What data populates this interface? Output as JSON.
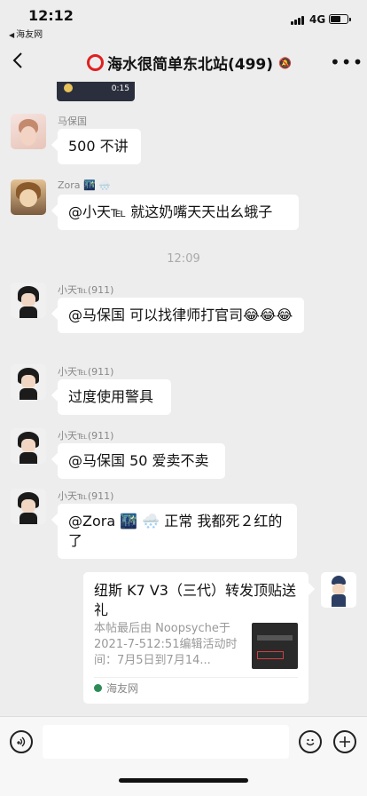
{
  "status_bar": {
    "time": "12:12",
    "back_app": "海友网",
    "network": "4G",
    "battery_level": 0.6
  },
  "header": {
    "title": "海水很简单东北站(499)"
  },
  "chat": {
    "video_duration": "0:15",
    "messages": [
      {
        "sender": "马保国",
        "text": "500 不讲"
      },
      {
        "sender": "Zora 🌃 🌨️",
        "text": "@小天℡ 就这奶嘴天天出幺蛾子"
      },
      {
        "sender": "小天℡(911)",
        "text": "@马保国 可以找律师打官司😂😂😂"
      },
      {
        "sender": "小天℡(911)",
        "text": "过度使用警具"
      },
      {
        "sender": "小天℡(911)",
        "text": "@马保国 50 爱卖不卖"
      },
      {
        "sender": "小天℡(911)",
        "text": "@Zora 🌃 🌨️ 正常 我都死２红的了"
      }
    ],
    "time_divider": "12:09",
    "card": {
      "title": "纽斯 K7 V3（三代）转发顶贴送礼",
      "desc": "本帖最后由 Noopsyche于 2021-7-512:51编辑活动时间：7月5日到7月14...",
      "source": "海友网"
    }
  },
  "icons": {
    "voice": "voice-icon",
    "emoji": "emoji-icon",
    "plus": "plus-icon",
    "back": "chevron-left-icon",
    "more": "more-icon",
    "mute": "mute-icon"
  },
  "colors": {
    "background": "#ededed",
    "bubble": "#ffffff",
    "group_ring": "#e02020"
  }
}
